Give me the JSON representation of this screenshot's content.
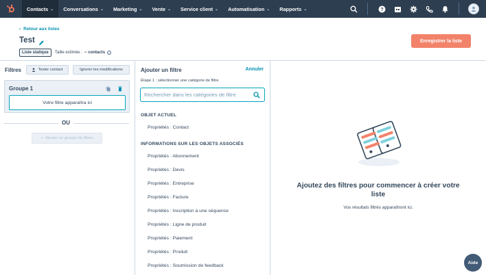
{
  "colors": {
    "nav_bg": "#2d3e50",
    "accent_link": "#0091ae",
    "primary_button": "#f2826a",
    "focus_border": "#00a4bd"
  },
  "topnav": {
    "logo_icon": "hubspot-sprocket-icon",
    "items": [
      {
        "label": "Contacts"
      },
      {
        "label": "Conversations"
      },
      {
        "label": "Marketing"
      },
      {
        "label": "Vente"
      },
      {
        "label": "Service client"
      },
      {
        "label": "Automatisation"
      },
      {
        "label": "Rapports"
      }
    ],
    "right_icons": [
      "search-icon",
      "help-icon",
      "marketplace-icon",
      "settings-icon",
      "calling-icon",
      "notifications-icon",
      "avatar"
    ]
  },
  "header": {
    "back_link": "Retour aux listes",
    "title": "Test",
    "save_button": "Enregistrer la liste",
    "list_type_badge": "Liste statique",
    "estimated_size_label": "Taille estimée :",
    "estimated_size_value": "-- contacts"
  },
  "filters_panel": {
    "title": "Filtres",
    "test_contact_button": "Tester contact",
    "ignore_changes_button": "Ignorer les modifications",
    "group_title": "Groupe 1",
    "filter_placeholder": "Votre filtre apparaîtra ici",
    "or_label": "OU",
    "add_group_button": "Ajouter un groupe de filtres"
  },
  "add_filter_panel": {
    "title": "Ajouter un filtre",
    "cancel_link": "Annuler",
    "step_label": "Étape 1 : sélectionner une catégorie de filtre",
    "search_placeholder": "Rechercher dans les catégories de filtre",
    "current_object_heading": "OBJET ACTUEL",
    "current_object_items": [
      "Propriétés : Contact"
    ],
    "associated_heading": "INFORMATIONS SUR LES OBJETS ASSOCIÉS",
    "associated_items": [
      "Propriétés : Abonnement",
      "Propriétés : Devis",
      "Propriétés : Entreprise",
      "Propriétés : Facture",
      "Propriétés : Inscription à une séquence",
      "Propriétés : Ligne de produit",
      "Propriétés : Paiement",
      "Propriétés : Produit",
      "Propriétés : Soumission de feedback"
    ]
  },
  "results_panel": {
    "illustration_icon": "filter-list-illustration",
    "title": "Ajoutez des filtres pour commencer à créer votre liste",
    "subtitle": "Vos résultats filtrés apparaîtront ici."
  },
  "help_button": "Aide"
}
